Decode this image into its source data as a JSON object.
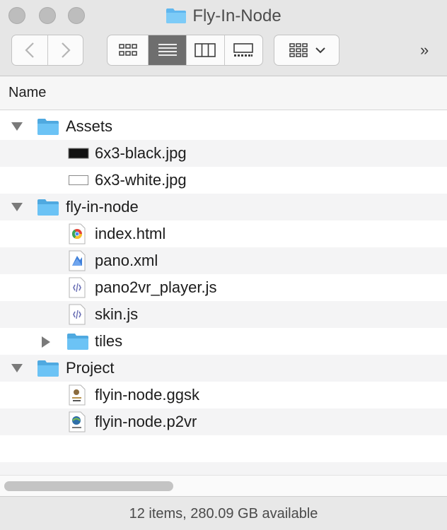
{
  "window": {
    "title": "Fly-In-Node"
  },
  "toolbar": {
    "back_icon": "chevron-left-icon",
    "forward_icon": "chevron-right-icon",
    "views": [
      "icon-view",
      "list-view",
      "column-view",
      "gallery-view"
    ],
    "active_view": "list-view",
    "group_icon": "group-by-icon",
    "more_label": "»"
  },
  "header": {
    "name_label": "Name"
  },
  "items": [
    {
      "name": "Assets",
      "kind": "folder",
      "level": 0,
      "expanded": true
    },
    {
      "name": "6x3-black.jpg",
      "kind": "jpg-black",
      "level": 1
    },
    {
      "name": "6x3-white.jpg",
      "kind": "jpg-white",
      "level": 1
    },
    {
      "name": "fly-in-node",
      "kind": "folder",
      "level": 0,
      "expanded": true
    },
    {
      "name": "index.html",
      "kind": "chrome-html",
      "level": 1
    },
    {
      "name": "pano.xml",
      "kind": "xml",
      "level": 1
    },
    {
      "name": "pano2vr_player.js",
      "kind": "js",
      "level": 1
    },
    {
      "name": "skin.js",
      "kind": "js",
      "level": 1
    },
    {
      "name": "tiles",
      "kind": "folder",
      "level": 1,
      "expanded": false
    },
    {
      "name": "Project",
      "kind": "folder",
      "level": 0,
      "expanded": true
    },
    {
      "name": "flyin-node.ggsk",
      "kind": "ggsk",
      "level": 1
    },
    {
      "name": "flyin-node.p2vr",
      "kind": "p2vr",
      "level": 1
    }
  ],
  "status": {
    "text": "12 items, 280.09 GB available"
  },
  "colors": {
    "folder": "#6cc3f5",
    "folder_dark": "#4fa9e0",
    "active_view": "#6e6e6e"
  }
}
